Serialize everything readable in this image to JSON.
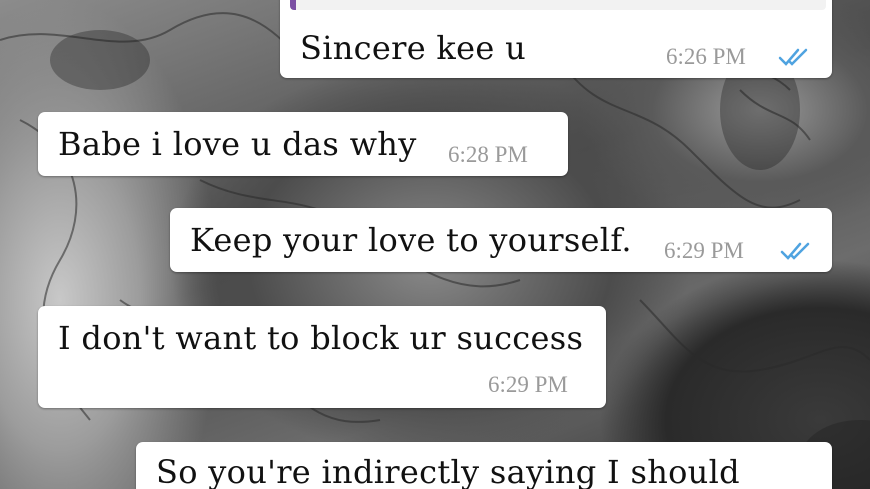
{
  "chat": {
    "messages": [
      {
        "direction": "outgoing",
        "text": "Sincere kee u",
        "time": "6:26 PM",
        "status": "double-check-read-icon",
        "has_quote": true
      },
      {
        "direction": "incoming",
        "text": "Babe i love u das why",
        "time": "6:28 PM"
      },
      {
        "direction": "outgoing",
        "text": "Keep your love to yourself.",
        "time": "6:29 PM",
        "status": "double-check-read-icon"
      },
      {
        "direction": "incoming",
        "text": "I don't want to block ur success",
        "time": "6:29 PM"
      },
      {
        "direction": "outgoing",
        "text": "So you're indirectly saying I should"
      }
    ]
  },
  "colors": {
    "bubble": "#ffffff",
    "timestamp": "#9a9a9a",
    "read_ticks": "#4fa3e0",
    "quote_bar": "#7b4fa3"
  }
}
